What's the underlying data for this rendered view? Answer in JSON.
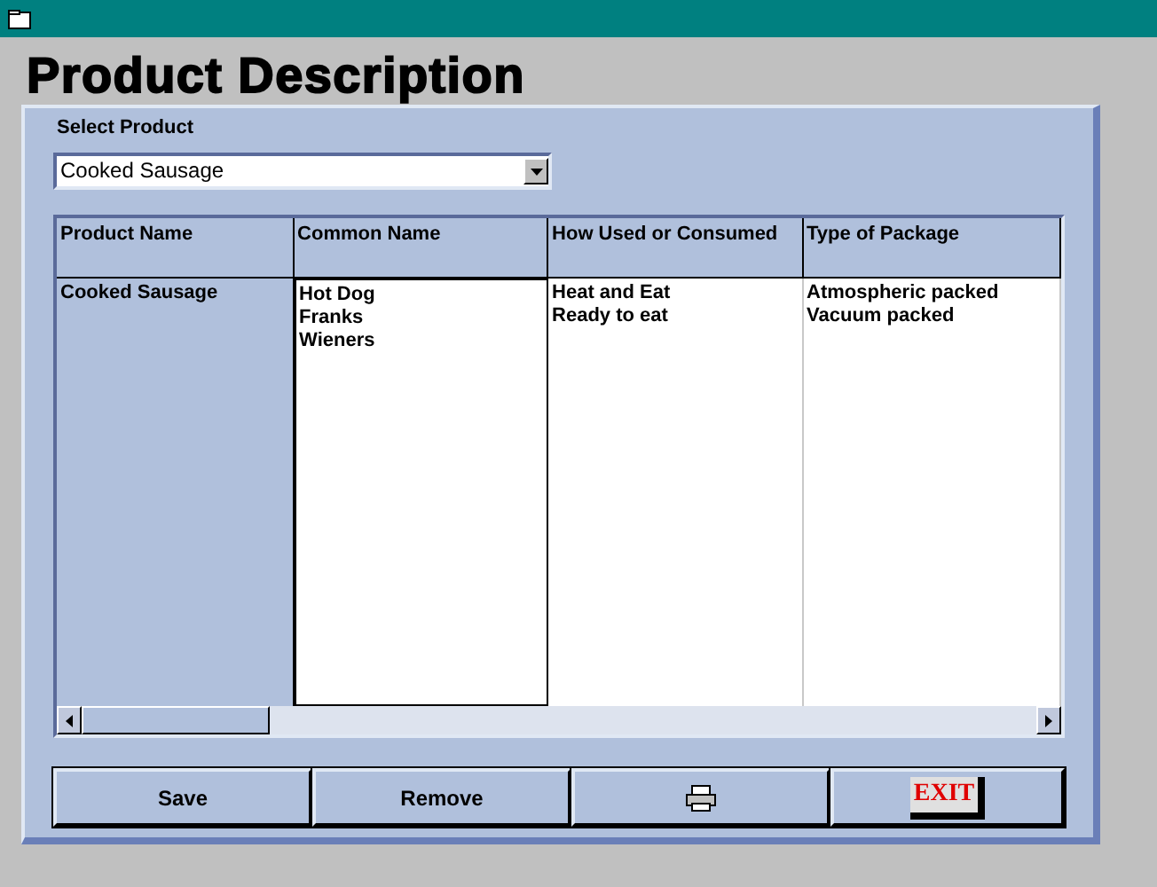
{
  "window": {
    "title": "Product Description"
  },
  "select_product": {
    "label": "Select Product",
    "value": "Cooked Sausage"
  },
  "table": {
    "columns": [
      "Product Name",
      "Common Name",
      "How Used or Consumed",
      "Type of Package"
    ],
    "rows": [
      {
        "cells": [
          {
            "lines": [
              "Cooked Sausage"
            ],
            "selected": false
          },
          {
            "lines": [
              "Hot Dog",
              "Franks",
              "Wieners"
            ],
            "selected": true
          },
          {
            "lines": [
              "Heat and Eat",
              "Ready to eat"
            ],
            "selected": false
          },
          {
            "lines": [
              "Atmospheric packed",
              "Vacuum packed"
            ],
            "selected": false
          }
        ]
      }
    ]
  },
  "buttons": [
    {
      "kind": "text",
      "label": "Save"
    },
    {
      "kind": "text",
      "label": "Remove"
    },
    {
      "kind": "print"
    },
    {
      "kind": "exit",
      "label": "EXIT"
    }
  ]
}
